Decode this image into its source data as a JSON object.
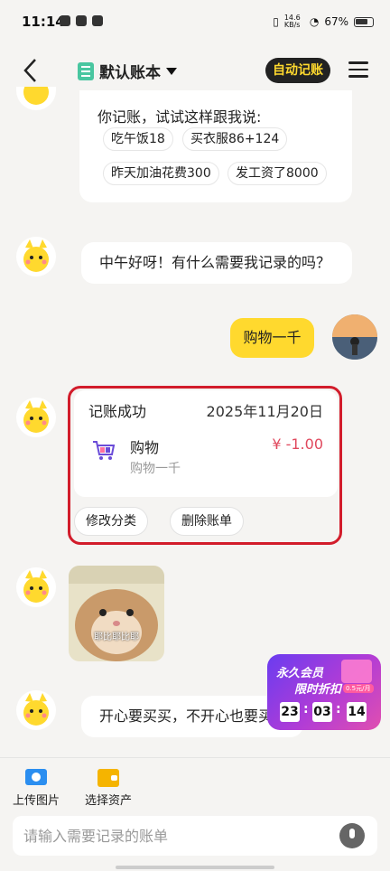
{
  "status_bar": {
    "time": "11:14",
    "net_speed": "14.6 KB/s",
    "battery": "67%"
  },
  "header": {
    "book_title": "默认账本",
    "auto_button": "自动记账"
  },
  "chat": {
    "hint_text": "你记账，试试这样跟我说:",
    "examples": [
      "吃午饭18",
      "买衣服86+124",
      "昨天加油花费300",
      "发工资了8000"
    ],
    "greeting": "中午好呀！有什么需要我记录的吗？",
    "user_message": "购物一千",
    "record": {
      "title": "记账成功",
      "date": "2025年11月20日",
      "category": "购物",
      "note": "购物一千",
      "amount": "¥ -1.00",
      "edit_button": "修改分类",
      "delete_button": "删除账单"
    },
    "meme_caption": "耶比耶比耶",
    "last_message": "开心要买买，不开心也要买买"
  },
  "promo": {
    "line1": "永久会员",
    "line2": "限时折扣",
    "tag": "0.5元/月",
    "countdown": [
      "23",
      "03",
      "14"
    ]
  },
  "bottom": {
    "upload_label": "上传图片",
    "asset_label": "选择资产",
    "input_placeholder": "请输入需要记录的账单"
  },
  "colors": {
    "accent_yellow": "#ffd92e",
    "highlight_red": "#d21c2b",
    "amount_red": "#e0485d"
  }
}
